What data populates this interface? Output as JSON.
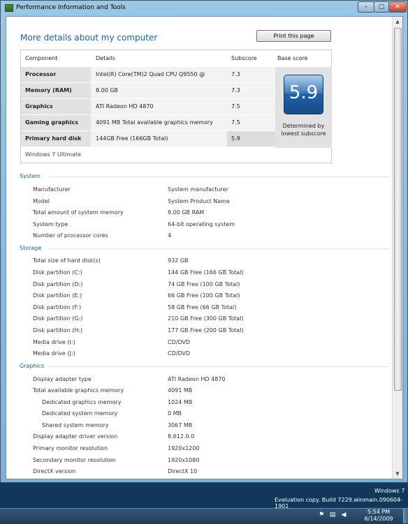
{
  "window": {
    "title": "Performance Information and Tools",
    "min_glyph": "–",
    "max_glyph": "□",
    "close_glyph": "✕"
  },
  "page": {
    "heading": "More details about my computer",
    "print_button": "Print this page"
  },
  "components": {
    "headers": {
      "component": "Component",
      "details": "Details",
      "subscore": "Subscore",
      "base": "Base score"
    },
    "rows": [
      {
        "name": "Processor",
        "details": "Intel(R) Core(TM)2 Quad CPU Q9550 @ 2.83GHz",
        "subscore": "7.3"
      },
      {
        "name": "Memory (RAM)",
        "details": "8.00 GB",
        "subscore": "7.3"
      },
      {
        "name": "Graphics",
        "details": "ATI Radeon HD 4870",
        "subscore": "7.5"
      },
      {
        "name": "Gaming graphics",
        "details": "4091 MB Total available graphics memory",
        "subscore": "7.5"
      },
      {
        "name": "Primary hard disk",
        "details": "144GB Free (166GB Total)",
        "subscore": "5.9"
      }
    ],
    "base_score": "5.9",
    "base_caption": "Determined by lowest subscore",
    "edition": "Windows 7 Ultimate"
  },
  "system": {
    "title": "System",
    "rows": [
      {
        "label": "Manufacturer",
        "value": "System manufacturer"
      },
      {
        "label": "Model",
        "value": "System Product Name"
      },
      {
        "label": "Total amount of system memory",
        "value": "8.00 GB RAM"
      },
      {
        "label": "System type",
        "value": "64-bit operating system"
      },
      {
        "label": "Number of processor cores",
        "value": "4"
      }
    ]
  },
  "storage": {
    "title": "Storage",
    "rows": [
      {
        "label": "Total size of hard disk(s)",
        "value": "932 GB"
      },
      {
        "label": "Disk partition (C:)",
        "value": "144 GB Free (166 GB Total)"
      },
      {
        "label": "Disk partition (D:)",
        "value": "74 GB Free (100 GB Total)"
      },
      {
        "label": "Disk partition (E:)",
        "value": "66 GB Free (100 GB Total)"
      },
      {
        "label": "Disk partition (F:)",
        "value": "58 GB Free (66 GB Total)"
      },
      {
        "label": "Disk partition (G:)",
        "value": "210 GB Free (300 GB Total)"
      },
      {
        "label": "Disk partition (H:)",
        "value": "177 GB Free (200 GB Total)"
      },
      {
        "label": "Media drive (I:)",
        "value": "CD/DVD"
      },
      {
        "label": "Media drive (J:)",
        "value": "CD/DVD"
      }
    ]
  },
  "graphics": {
    "title": "Graphics",
    "rows": [
      {
        "label": "Display adapter type",
        "value": "ATI Radeon HD 4870",
        "indent": false
      },
      {
        "label": "Total available graphics memory",
        "value": "4091 MB",
        "indent": false
      },
      {
        "label": "Dedicated graphics memory",
        "value": "1024 MB",
        "indent": true
      },
      {
        "label": "Dedicated system memory",
        "value": "0 MB",
        "indent": true
      },
      {
        "label": "Shared system memory",
        "value": "3067 MB",
        "indent": true
      },
      {
        "label": "Display adapter driver version",
        "value": "8.612.0.0",
        "indent": false
      },
      {
        "label": "Primary monitor resolution",
        "value": "1920x1200",
        "indent": false
      },
      {
        "label": "Secondary monitor resolution",
        "value": "1920x1080",
        "indent": false
      },
      {
        "label": "DirectX version",
        "value": "DirectX 10",
        "indent": false
      }
    ]
  },
  "watermark": {
    "line1": "Windows 7",
    "line2": "Evaluation copy. Build 7229.winmain.090604-1901"
  },
  "taskbar": {
    "time": "5:54 PM",
    "date": "6/14/2009",
    "tray_icons": [
      "flag-icon",
      "network-icon",
      "volume-icon"
    ]
  }
}
